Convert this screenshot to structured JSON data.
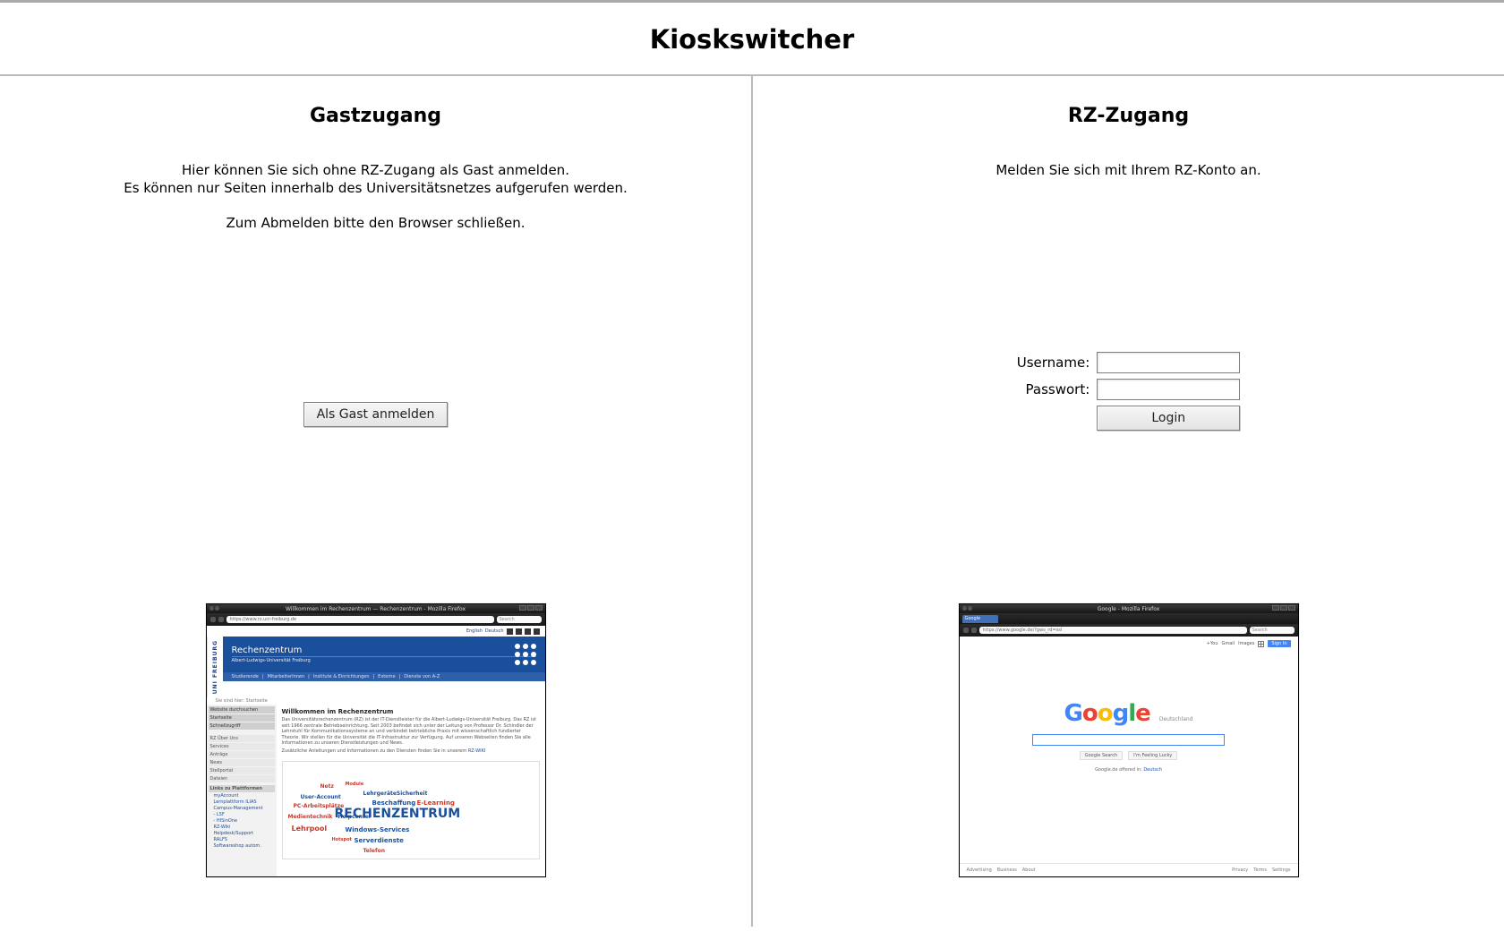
{
  "header": {
    "title": "Kioskswitcher"
  },
  "guest": {
    "title": "Gastzugang",
    "line1": "Hier können Sie sich ohne RZ-Zugang als Gast anmelden.",
    "line2": "Es können nur Seiten innerhalb des Universitätsnetzes aufgerufen werden.",
    "line3": "Zum Abmelden bitte den Browser schließen.",
    "button": "Als Gast anmelden"
  },
  "rz": {
    "title": "RZ-Zugang",
    "line1": "Melden Sie sich mit Ihrem RZ-Konto an.",
    "username_label": "Username:",
    "password_label": "Passwort:",
    "login_button": "Login",
    "username_value": "",
    "password_value": ""
  },
  "preview_left": {
    "window_title": "Willkommen im Rechenzentrum — Rechenzentrum - Mozilla Firefox",
    "url": "https://www.rz.uni-freiburg.de",
    "search_placeholder": "Search",
    "top_links": [
      "English",
      "Deutsch"
    ],
    "brand_vertical": "UNI FREIBURG",
    "banner_title": "Rechenzentrum",
    "banner_sub": "Albert-Ludwigs-Universität Freiburg",
    "nav": [
      "Studierende",
      "MitarbeiterInnen",
      "Institute & Einrichtungen",
      "Externe",
      "Dienste von A-Z"
    ],
    "breadcrumb": "Sie sind hier: Startseite",
    "sidebar_top": [
      "Website durchsuchen",
      "Startseite",
      "Schnellzugriff"
    ],
    "sidebar_mid": [
      "RZ Über Uns",
      "Services",
      "Anträge",
      "News",
      "Stellportal",
      "Dateien"
    ],
    "sidebar_header": "Links zu Plattformen",
    "sidebar_links": [
      "myAccount",
      "Lernplattform ILIAS",
      "Campus-Management",
      "- LSF",
      "- HISinOne",
      "RZ-Wiki",
      "Helpdesk/Support",
      "RALFS",
      "Softwareshop autom."
    ],
    "article_title": "Willkommen im Rechenzentrum",
    "article_body": "Das Universitätsrechenzentrum (RZ) ist der IT-Dienstleister für die Albert-Ludwigs-Universität Freiburg. Das RZ ist seit 1966 zentrale Betriebseinrichtung. Seit 2003 befindet sich unter der Leitung von Professor Dr. Schindler der Lehrstuhl für Kommunikationssysteme an und verbindet betriebliche Praxis mit wissenschaftlich fundierter Theorie. Wir stellen für die Universität die IT-Infrastruktur zur Verfügung. Auf unseren Webseiten finden Sie alle Informationen zu unseren Dienstleistungen und News.",
    "article_extra": "Zusätzliche Anleitungen und Informationen zu den Diensten finden Sie in unserem",
    "article_extra_link": "RZ-WIKI",
    "wordcloud_big": "RECHENZENTRUM",
    "wordcloud_words": [
      "Netz",
      "Module",
      "User-Account",
      "PC-Arbeitsplätze",
      "LehrgeräteSicherheit",
      "Beschaffung",
      "E-Learning",
      "Medientechnik",
      "Helpcenter",
      "Lehrpool",
      "Windows-Services",
      "Serverdienste",
      "Telefon",
      "Hotspot"
    ]
  },
  "preview_right": {
    "window_title": "Google - Mozilla Firefox",
    "tab_label": "Google",
    "url": "https://www.google.de/?gws_rd=ssl",
    "search_placeholder": "Search",
    "top_links": [
      "+You",
      "Gmail",
      "Images"
    ],
    "signin": "Sign In",
    "logo_text": "Google",
    "logo_region": "Deutschland",
    "btn_search": "Google Search",
    "btn_lucky": "I'm Feeling Lucky",
    "offered_text": "Google.de offered in:",
    "offered_link": "Deutsch",
    "footer_left": [
      "Advertising",
      "Business",
      "About"
    ],
    "footer_right": [
      "Privacy",
      "Terms",
      "Settings"
    ]
  }
}
